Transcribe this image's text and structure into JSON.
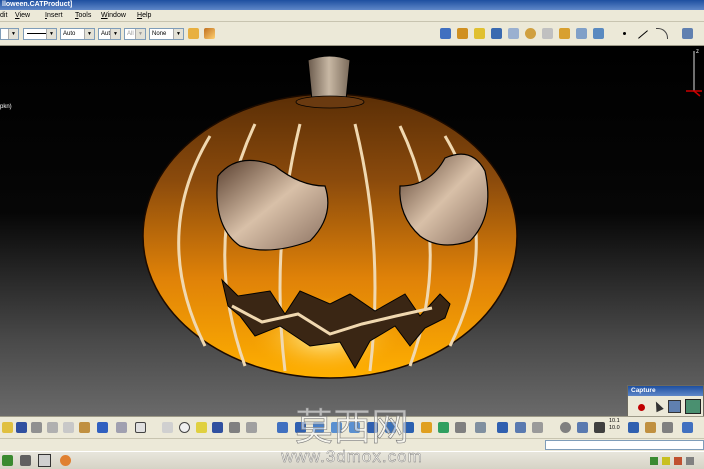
{
  "window": {
    "title": "lloween.CATProduct]"
  },
  "menu": [
    {
      "label": "Edit",
      "shown": "dit",
      "key": ""
    },
    {
      "label": "View",
      "shown": "View",
      "key": "V"
    },
    {
      "label": "Insert",
      "shown": "Insert",
      "key": "I"
    },
    {
      "label": "Tools",
      "shown": "Tools",
      "key": "T"
    },
    {
      "label": "Window",
      "shown": "Window",
      "key": "W"
    },
    {
      "label": "Help",
      "shown": "Help",
      "key": "H"
    }
  ],
  "toolbar": {
    "line_type": "",
    "line_thickness": "Auto",
    "point_type": "Aut",
    "layer": "All",
    "render_style": "None"
  },
  "tree": {
    "partial_node": "pkn)"
  },
  "capture_panel": {
    "title": "Capture"
  },
  "compass": {
    "label": "z"
  },
  "bottom_bar": {
    "ratio_top": "10.1",
    "ratio_bottom": "10.0"
  },
  "watermark": {
    "chinese": "莫西网",
    "url": "www.3dmox.com"
  },
  "colors": {
    "pumpkin_top": "#7a3c06",
    "pumpkin_bottom": "#ffb000",
    "glow": "#fff2a0",
    "ui_bg": "#ece9d8"
  }
}
